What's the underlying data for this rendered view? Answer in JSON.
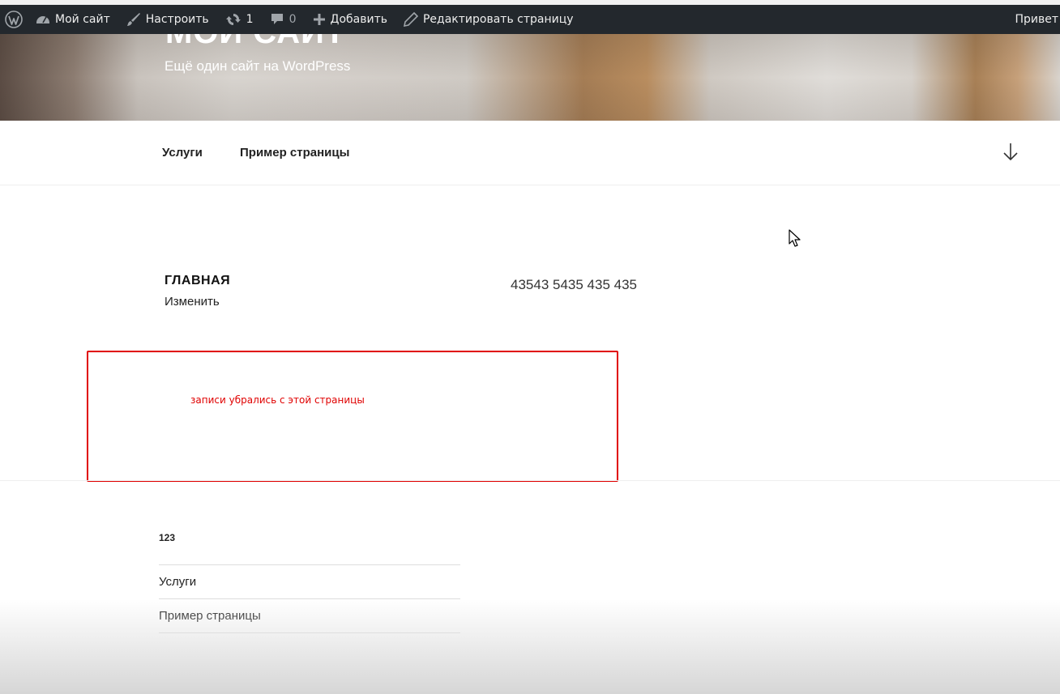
{
  "admin_bar": {
    "site_name": "Мой сайт",
    "customize": "Настроить",
    "updates_count": "1",
    "comments_count": "0",
    "add_new": "Добавить",
    "edit_page": "Редактировать страницу",
    "greeting": "Привет"
  },
  "header": {
    "site_title": "МОЙ САЙТ",
    "tagline": "Ещё один сайт на WordPress"
  },
  "nav": {
    "items": [
      "Услуги",
      "Пример страницы"
    ]
  },
  "page": {
    "title": "ГЛАВНАЯ",
    "edit_link": "Изменить",
    "content": "43543 5435 435 435"
  },
  "annotation": {
    "text": "записи убрались с этой страницы",
    "color": "#e00000"
  },
  "widget": {
    "title": "123",
    "items": [
      "Услуги",
      "Пример страницы"
    ]
  },
  "colors": {
    "admin_bar_bg": "#23282d",
    "admin_icon": "#a0a5aa"
  }
}
